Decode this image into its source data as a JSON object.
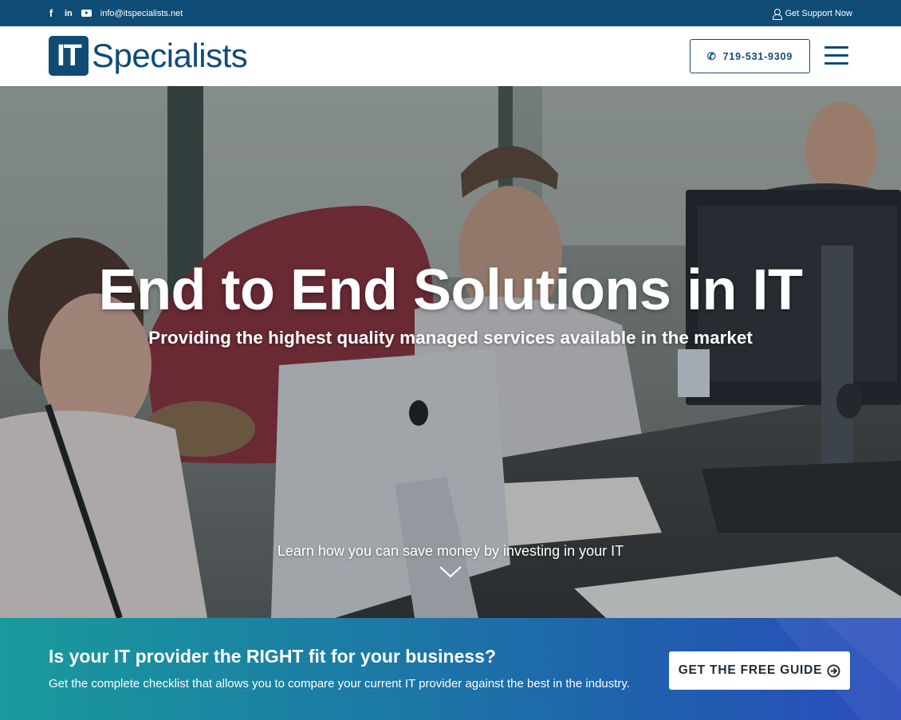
{
  "topbar": {
    "social_icons": [
      "facebook-icon",
      "linkedin-icon",
      "youtube-icon"
    ],
    "facebook_glyph": "f",
    "linkedin_glyph": "in",
    "email": "info@itspecialists.net",
    "support_label": "Get Support Now"
  },
  "header": {
    "logo_mark": "IT",
    "logo_word": "Specialists",
    "phone": "719-531-9309",
    "menu_icon": "hamburger-icon"
  },
  "hero": {
    "title": "End to End Solutions in IT",
    "subtitle": "Providing the highest quality managed services available in the market",
    "learn_more": "Learn how you can save money by investing in your IT",
    "scroll_icon": "chevron-down-icon"
  },
  "cta": {
    "title": "Is your IT provider the RIGHT fit for your business?",
    "text": "Get the complete checklist that allows you to compare your current IT provider against the best in the industry.",
    "button_label": "GET THE FREE GUIDE",
    "button_icon": "arrow-circle-icon"
  },
  "colors": {
    "brand_navy": "#0f4c75",
    "cta_gradient_start": "#1a9a9c",
    "cta_gradient_end": "#2a4bbd",
    "white": "#ffffff"
  }
}
